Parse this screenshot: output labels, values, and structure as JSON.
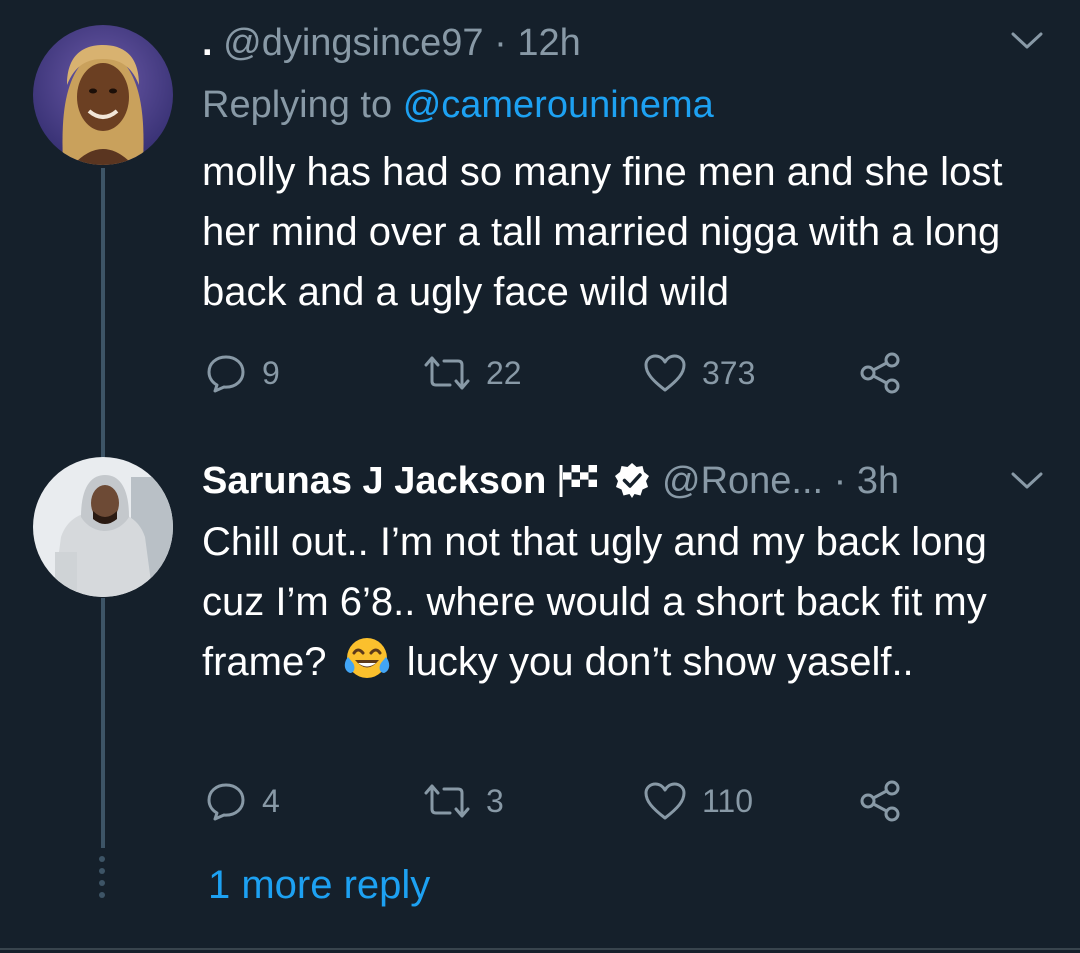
{
  "tweets": [
    {
      "display_name": ".",
      "handle": "@dyingsince97",
      "separator": "·",
      "time": "12h",
      "replying_prefix": "Replying to",
      "replying_handle": "@camerouninema",
      "text": "molly has had so many fine men and she lost her mind over a tall married nigga with a long back and a ugly face wild wild",
      "replies": "9",
      "retweets": "22",
      "likes": "373"
    },
    {
      "display_name": "Sarunas J Jackson",
      "handle": "@Rone...",
      "separator": "·",
      "time": "3h",
      "text_part1": "Chill out.. I’m not that ugly and my back long cuz I’m 6’8.. where would a short back fit my frame?",
      "text_part2": "lucky you don’t show yaself..",
      "replies": "4",
      "retweets": "3",
      "likes": "110"
    }
  ],
  "more_replies": "1 more reply",
  "icons": [
    "chevron-down-icon",
    "reply-icon",
    "retweet-icon",
    "like-icon",
    "share-icon",
    "checkered-flag-icon",
    "verified-badge-icon",
    "tears-of-joy-emoji"
  ],
  "colors": {
    "background": "#15202b",
    "text": "#ffffff",
    "muted": "#8899a6",
    "accent": "#1da1f2",
    "thread_line": "#3d5466"
  }
}
